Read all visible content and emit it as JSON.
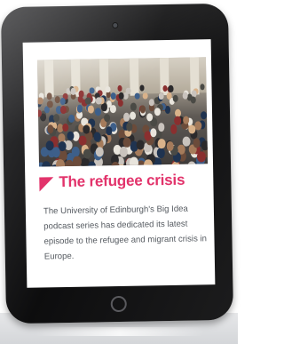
{
  "article": {
    "title": "The refugee crisis",
    "body": "The University of Edinburgh's Big Idea podcast series has dedicated its latest episode to the refugee and migrant crisis in Europe."
  },
  "colors": {
    "accent": "#e2336b",
    "body_text": "#555a60",
    "device_bezel": "#1c1c1d"
  },
  "icons": {
    "flag": "pink-corner-flag-icon",
    "camera": "front-camera-icon",
    "home": "home-button-icon"
  }
}
